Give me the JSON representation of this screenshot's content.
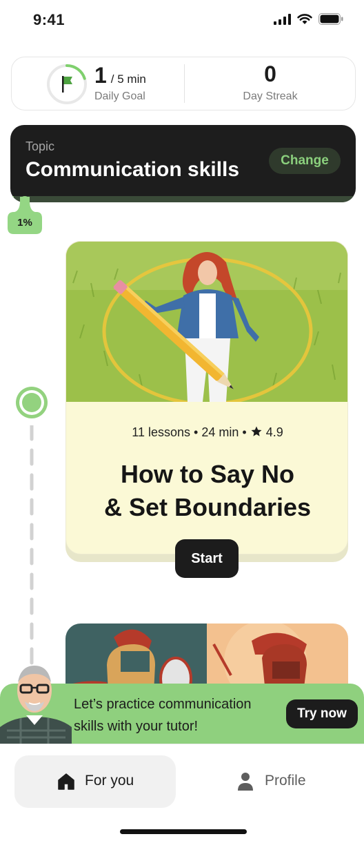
{
  "status_bar": {
    "time": "9:41"
  },
  "goal": {
    "value": "1",
    "target": "/ 5 min",
    "label": "Daily Goal",
    "progress_fraction": 0.2,
    "streak_value": "0",
    "streak_label": "Day Streak"
  },
  "topic": {
    "label": "Topic",
    "title": "Communication skills",
    "change_label": "Change",
    "progress_text": "1%",
    "progress_percent": 1
  },
  "course": {
    "lessons": "11 lessons",
    "duration": "24 min",
    "rating": "4.9",
    "title_line1": "How to Say No",
    "title_line2": "& Set Boundaries",
    "start_label": "Start"
  },
  "tutor_banner": {
    "text": "Let’s practice communication skills with your tutor!",
    "button_label": "Try now"
  },
  "tabs": [
    {
      "label": "For you",
      "icon": "home-icon",
      "active": true
    },
    {
      "label": "Profile",
      "icon": "person-icon",
      "active": false
    }
  ],
  "colors": {
    "accent_green": "#8fd07e",
    "topic_dark": "#1d1d1d",
    "card_cream": "#fbf9d6"
  }
}
